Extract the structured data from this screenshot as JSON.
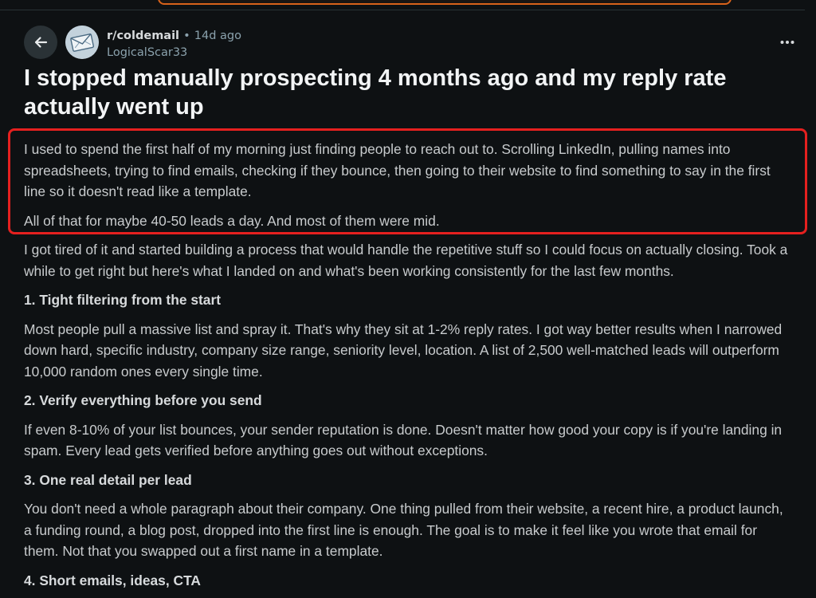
{
  "header": {
    "back_icon": "arrow-left-icon",
    "avatar_icon": "mail-envelope-icon",
    "subreddit": "r/coldemail",
    "separator": "•",
    "age": "14d ago",
    "username": "LogicalScar33",
    "more_icon": "three-dots-icon"
  },
  "post": {
    "title": "I stopped manually prospecting 4 months ago and my reply rate actually went up",
    "paragraphs": [
      "I used to spend the first half of my morning just finding people to reach out to. Scrolling LinkedIn, pulling names into spreadsheets, trying to find emails, checking if they bounce, then going to their website to find something to say in the first line so it doesn't read like a template.",
      "All of that for maybe 40-50 leads a day. And most of them were mid.",
      "I got tired of it and started building a process that would handle the repetitive stuff so I could focus on actually closing. Took a while to get right but here's what I landed on and what's been working consistently for the last few months."
    ],
    "sections": [
      {
        "heading": "1. Tight filtering from the start",
        "text": "Most people pull a massive list and spray it. That's why they sit at 1-2% reply rates. I got way better results when I narrowed down hard, specific industry, company size range, seniority level, location. A list of 2,500 well-matched leads will outperform 10,000 random ones every single time."
      },
      {
        "heading": "2. Verify everything before you send",
        "text": "If even 8-10% of your list bounces, your sender reputation is done. Doesn't matter how good your copy is if you're landing in spam. Every lead gets verified before anything goes out without exceptions."
      },
      {
        "heading": "3. One real detail per lead",
        "text": "You don't need a whole paragraph about their company. One thing pulled from their website, a recent hire, a product launch, a funding round, a blog post, dropped into the first line is enough. The goal is to make it feel like you wrote that email for them. Not that you swapped out a first name in a template."
      },
      {
        "heading": "4. Short emails, ideas, CTA",
        "text": ""
      }
    ]
  },
  "colors": {
    "background": "#0e1113",
    "highlight_border": "#e5201f",
    "topbar_accent": "#d9621a"
  }
}
